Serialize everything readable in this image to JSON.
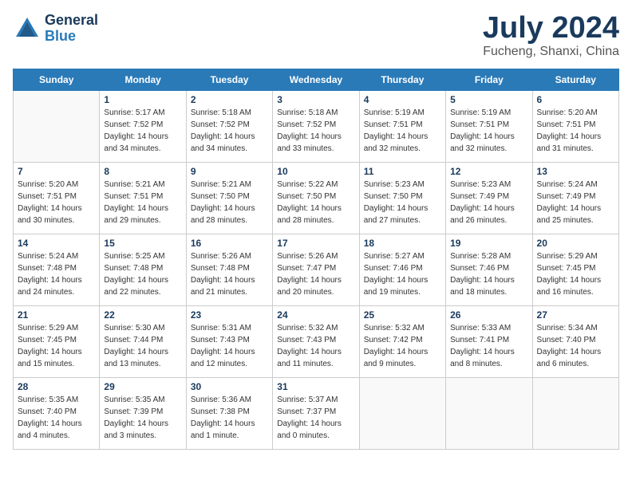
{
  "header": {
    "logo_general": "General",
    "logo_blue": "Blue",
    "month_title": "July 2024",
    "location": "Fucheng, Shanxi, China"
  },
  "days_of_week": [
    "Sunday",
    "Monday",
    "Tuesday",
    "Wednesday",
    "Thursday",
    "Friday",
    "Saturday"
  ],
  "weeks": [
    [
      {
        "day": "",
        "info": ""
      },
      {
        "day": "1",
        "info": "Sunrise: 5:17 AM\nSunset: 7:52 PM\nDaylight: 14 hours\nand 34 minutes."
      },
      {
        "day": "2",
        "info": "Sunrise: 5:18 AM\nSunset: 7:52 PM\nDaylight: 14 hours\nand 34 minutes."
      },
      {
        "day": "3",
        "info": "Sunrise: 5:18 AM\nSunset: 7:52 PM\nDaylight: 14 hours\nand 33 minutes."
      },
      {
        "day": "4",
        "info": "Sunrise: 5:19 AM\nSunset: 7:51 PM\nDaylight: 14 hours\nand 32 minutes."
      },
      {
        "day": "5",
        "info": "Sunrise: 5:19 AM\nSunset: 7:51 PM\nDaylight: 14 hours\nand 32 minutes."
      },
      {
        "day": "6",
        "info": "Sunrise: 5:20 AM\nSunset: 7:51 PM\nDaylight: 14 hours\nand 31 minutes."
      }
    ],
    [
      {
        "day": "7",
        "info": "Sunrise: 5:20 AM\nSunset: 7:51 PM\nDaylight: 14 hours\nand 30 minutes."
      },
      {
        "day": "8",
        "info": "Sunrise: 5:21 AM\nSunset: 7:51 PM\nDaylight: 14 hours\nand 29 minutes."
      },
      {
        "day": "9",
        "info": "Sunrise: 5:21 AM\nSunset: 7:50 PM\nDaylight: 14 hours\nand 28 minutes."
      },
      {
        "day": "10",
        "info": "Sunrise: 5:22 AM\nSunset: 7:50 PM\nDaylight: 14 hours\nand 28 minutes."
      },
      {
        "day": "11",
        "info": "Sunrise: 5:23 AM\nSunset: 7:50 PM\nDaylight: 14 hours\nand 27 minutes."
      },
      {
        "day": "12",
        "info": "Sunrise: 5:23 AM\nSunset: 7:49 PM\nDaylight: 14 hours\nand 26 minutes."
      },
      {
        "day": "13",
        "info": "Sunrise: 5:24 AM\nSunset: 7:49 PM\nDaylight: 14 hours\nand 25 minutes."
      }
    ],
    [
      {
        "day": "14",
        "info": "Sunrise: 5:24 AM\nSunset: 7:48 PM\nDaylight: 14 hours\nand 24 minutes."
      },
      {
        "day": "15",
        "info": "Sunrise: 5:25 AM\nSunset: 7:48 PM\nDaylight: 14 hours\nand 22 minutes."
      },
      {
        "day": "16",
        "info": "Sunrise: 5:26 AM\nSunset: 7:48 PM\nDaylight: 14 hours\nand 21 minutes."
      },
      {
        "day": "17",
        "info": "Sunrise: 5:26 AM\nSunset: 7:47 PM\nDaylight: 14 hours\nand 20 minutes."
      },
      {
        "day": "18",
        "info": "Sunrise: 5:27 AM\nSunset: 7:46 PM\nDaylight: 14 hours\nand 19 minutes."
      },
      {
        "day": "19",
        "info": "Sunrise: 5:28 AM\nSunset: 7:46 PM\nDaylight: 14 hours\nand 18 minutes."
      },
      {
        "day": "20",
        "info": "Sunrise: 5:29 AM\nSunset: 7:45 PM\nDaylight: 14 hours\nand 16 minutes."
      }
    ],
    [
      {
        "day": "21",
        "info": "Sunrise: 5:29 AM\nSunset: 7:45 PM\nDaylight: 14 hours\nand 15 minutes."
      },
      {
        "day": "22",
        "info": "Sunrise: 5:30 AM\nSunset: 7:44 PM\nDaylight: 14 hours\nand 13 minutes."
      },
      {
        "day": "23",
        "info": "Sunrise: 5:31 AM\nSunset: 7:43 PM\nDaylight: 14 hours\nand 12 minutes."
      },
      {
        "day": "24",
        "info": "Sunrise: 5:32 AM\nSunset: 7:43 PM\nDaylight: 14 hours\nand 11 minutes."
      },
      {
        "day": "25",
        "info": "Sunrise: 5:32 AM\nSunset: 7:42 PM\nDaylight: 14 hours\nand 9 minutes."
      },
      {
        "day": "26",
        "info": "Sunrise: 5:33 AM\nSunset: 7:41 PM\nDaylight: 14 hours\nand 8 minutes."
      },
      {
        "day": "27",
        "info": "Sunrise: 5:34 AM\nSunset: 7:40 PM\nDaylight: 14 hours\nand 6 minutes."
      }
    ],
    [
      {
        "day": "28",
        "info": "Sunrise: 5:35 AM\nSunset: 7:40 PM\nDaylight: 14 hours\nand 4 minutes."
      },
      {
        "day": "29",
        "info": "Sunrise: 5:35 AM\nSunset: 7:39 PM\nDaylight: 14 hours\nand 3 minutes."
      },
      {
        "day": "30",
        "info": "Sunrise: 5:36 AM\nSunset: 7:38 PM\nDaylight: 14 hours\nand 1 minute."
      },
      {
        "day": "31",
        "info": "Sunrise: 5:37 AM\nSunset: 7:37 PM\nDaylight: 14 hours\nand 0 minutes."
      },
      {
        "day": "",
        "info": ""
      },
      {
        "day": "",
        "info": ""
      },
      {
        "day": "",
        "info": ""
      }
    ]
  ]
}
